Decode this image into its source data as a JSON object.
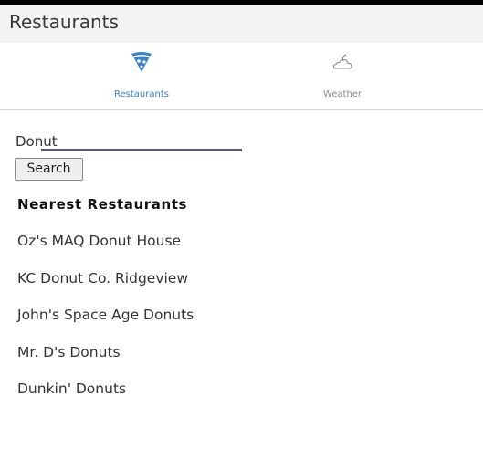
{
  "app": {
    "title": "Restaurants"
  },
  "tabs": [
    {
      "label": "Restaurants",
      "icon": "pizza-icon",
      "selected": true,
      "color": "#3e82c0"
    },
    {
      "label": "Weather",
      "icon": "cloud-moon-icon",
      "selected": false,
      "color": "#8a8a8a"
    }
  ],
  "search": {
    "value": "Donut",
    "button_label": "Search"
  },
  "results": {
    "heading": "Nearest Restaurants",
    "items": [
      "Oz's MAQ Donut House",
      "KC Donut Co. Ridgeview",
      "John's Space Age Donuts",
      "Mr. D's Donuts",
      "Dunkin' Donuts"
    ]
  }
}
